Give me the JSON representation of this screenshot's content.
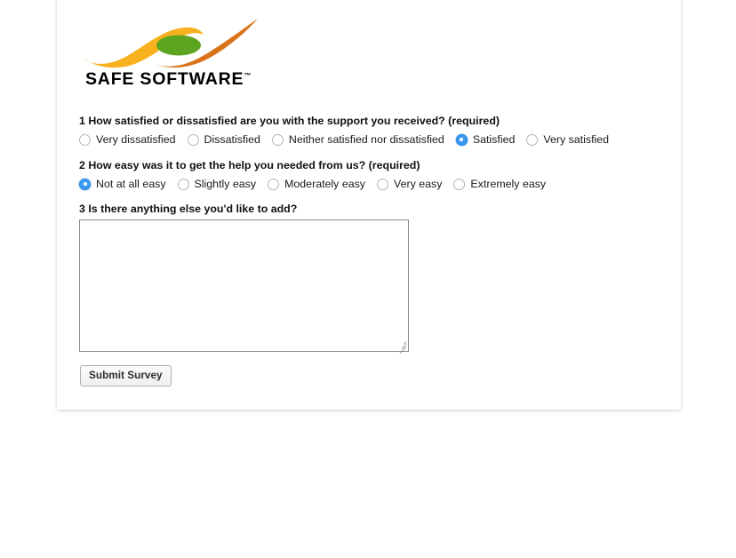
{
  "brand": {
    "name": "SAFE SOFTWARE",
    "trademark": "™",
    "colors": {
      "yellow": "#f7b11e",
      "orange": "#d9731a",
      "green": "#5da520",
      "accent_blue": "#3b9bf3"
    }
  },
  "survey": {
    "questions": [
      {
        "number": "1",
        "text": "1 How satisfied or dissatisfied are you with the support you received? (required)",
        "options": [
          {
            "label": "Very dissatisfied",
            "checked": false
          },
          {
            "label": "Dissatisfied",
            "checked": false
          },
          {
            "label": "Neither satisfied nor dissatisfied",
            "checked": false
          },
          {
            "label": "Satisfied",
            "checked": true
          },
          {
            "label": "Very satisfied",
            "checked": false
          }
        ]
      },
      {
        "number": "2",
        "text": "2 How easy was it to get the help you needed from us? (required)",
        "options": [
          {
            "label": "Not at all easy",
            "checked": true
          },
          {
            "label": "Slightly easy",
            "checked": false
          },
          {
            "label": "Moderately easy",
            "checked": false
          },
          {
            "label": "Very easy",
            "checked": false
          },
          {
            "label": "Extremely easy",
            "checked": false
          }
        ]
      },
      {
        "number": "3",
        "text": "3 Is there anything else you'd like to add?",
        "comment": {
          "value": "",
          "placeholder": ""
        }
      }
    ],
    "submit_label": "Submit Survey"
  }
}
